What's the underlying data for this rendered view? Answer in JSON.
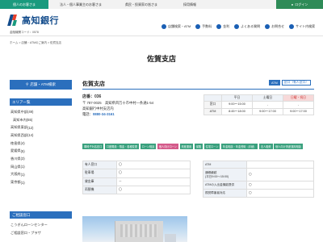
{
  "topnav": {
    "items": [
      "個人のお客さま",
      "法人・個人事業主のお客さま",
      "県民・投資家の皆さま",
      "採用情報"
    ],
    "active_index": 0,
    "login_label": "ログイン"
  },
  "header": {
    "logo_text": "高知銀行",
    "bank_code": "金融機関コード：0578",
    "links": [
      "店舗検索・ATM",
      "手数料",
      "金利",
      "よくある質問",
      "お問合せ",
      "サイト内検索"
    ]
  },
  "breadcrumb": "ホーム > 店舗・ATMのご案内 > 佐賀支店",
  "page_title": "佐賀支店",
  "sidebar": {
    "search_button": "店舗・ATM検索",
    "area_heading": "エリア一覧",
    "areas": [
      {
        "name": "高知県中部",
        "count": "(49)"
      },
      {
        "name": "高知市内",
        "count": "(55)"
      },
      {
        "name": "高知県東部",
        "count": "(12)"
      },
      {
        "name": "高知県西部",
        "count": "(14)"
      },
      {
        "name": "徳島県",
        "count": "(4)"
      },
      {
        "name": "愛媛県",
        "count": "(5)"
      },
      {
        "name": "香川県",
        "count": "(3)"
      },
      {
        "name": "岡山県",
        "count": "(1)"
      },
      {
        "name": "大阪府",
        "count": "(1)"
      },
      {
        "name": "東京都",
        "count": "(1)"
      }
    ],
    "consult_heading": "ご相談窓口",
    "consult_items": [
      "こうぎんローンセンター",
      "ご相談窓口・プラザ"
    ]
  },
  "branch": {
    "name": "佐賀支店",
    "tags": [
      "ATM",
      "窓口（有人窓口）"
    ],
    "store_no": "店番：036",
    "address": "〒 787-0025　高知県四万十市中村一条通1-54",
    "location": "高知銀行中村支店内",
    "tel_label": "電話：",
    "tel": "0880-34-3161"
  },
  "hours": {
    "headers": [
      "",
      "平日",
      "土曜日",
      "日曜・祝日"
    ],
    "rows": [
      {
        "label": "窓口",
        "cells": [
          "9:00～15:00",
          "-",
          "-"
        ]
      },
      {
        "label": "ATM",
        "cells": [
          "8:45～18:00",
          "9:00～17:00",
          "9:00～17:00"
        ]
      }
    ]
  },
  "services": [
    {
      "label": "車椅子対応窓口",
      "state": "on"
    },
    {
      "label": "口座開設・預金・各種変更",
      "state": "on"
    },
    {
      "label": "ローン相談",
      "state": "on"
    },
    {
      "label": "個人向けローン",
      "state": "pk"
    },
    {
      "label": "資産運用",
      "state": "on"
    },
    {
      "label": "保険",
      "state": "on"
    },
    {
      "label": "住宅ローン",
      "state": "on"
    },
    {
      "label": "年金相談・年金受取（手続）",
      "state": "on"
    },
    {
      "label": "法人融資",
      "state": "on"
    },
    {
      "label": "個人向け資産運用相談",
      "state": "on"
    }
  ],
  "left_table": [
    {
      "label": "有人窓口",
      "value": "〇"
    },
    {
      "label": "駐車場",
      "value": "〇"
    },
    {
      "label": "貸金庫",
      "value": "－"
    },
    {
      "label": "両替機",
      "value": "〇"
    }
  ],
  "right_table": [
    {
      "label": "ATM",
      "value": ""
    },
    {
      "label": "通帳繰越\n(平日9:00～15:00)",
      "value": "〇"
    },
    {
      "label": "ATMの入出金機能提供",
      "value": "〇"
    },
    {
      "label": "視覚障害者対応",
      "value": "〇"
    }
  ]
}
